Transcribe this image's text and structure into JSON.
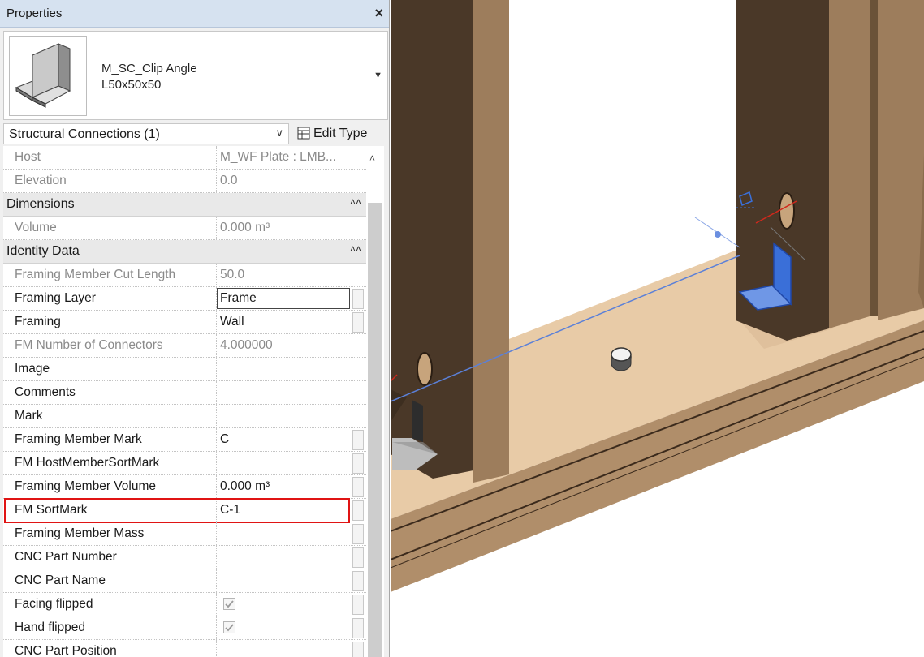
{
  "palette": {
    "title": "Properties",
    "close_glyph": "×",
    "type": {
      "family": "M_SC_Clip Angle",
      "size": "L50x50x50",
      "dropdown_glyph": "▼"
    },
    "filter": {
      "label": "Structural Connections (1)",
      "chevron": "∨"
    },
    "edit_type": {
      "label": "Edit Type",
      "icon": "edit-type-icon"
    },
    "scroll_up_glyph": "˄",
    "collapse_glyph": "˄˄",
    "rows": [
      {
        "kind": "row",
        "label": "Host",
        "value": "M_WF Plate : LMB...",
        "readonly": true,
        "button": false
      },
      {
        "kind": "row",
        "label": "Elevation",
        "value": "0.0",
        "readonly": true,
        "button": false
      },
      {
        "kind": "group",
        "label": "Dimensions"
      },
      {
        "kind": "row",
        "label": "Volume",
        "value": "0.000 m³",
        "readonly": true,
        "button": false
      },
      {
        "kind": "group",
        "label": "Identity Data"
      },
      {
        "kind": "row",
        "label": "Framing Member Cut Length",
        "value": "50.0",
        "readonly": true,
        "button": false
      },
      {
        "kind": "row",
        "label": "Framing Layer",
        "value": "Frame",
        "readonly": false,
        "button": true,
        "editing": true
      },
      {
        "kind": "row",
        "label": "Framing",
        "value": "Wall",
        "readonly": false,
        "button": true
      },
      {
        "kind": "row",
        "label": "FM Number of Connectors",
        "value": "4.000000",
        "readonly": true,
        "button": false
      },
      {
        "kind": "row",
        "label": "Image",
        "value": "",
        "readonly": false,
        "button": false
      },
      {
        "kind": "row",
        "label": "Comments",
        "value": "",
        "readonly": false,
        "button": false
      },
      {
        "kind": "row",
        "label": "Mark",
        "value": "",
        "readonly": false,
        "button": false
      },
      {
        "kind": "row",
        "label": "Framing Member Mark",
        "value": "C",
        "readonly": false,
        "button": true
      },
      {
        "kind": "row",
        "label": "FM HostMemberSortMark",
        "value": "",
        "readonly": false,
        "button": true
      },
      {
        "kind": "row",
        "label": "Framing Member Volume",
        "value": "0.000 m³",
        "readonly": false,
        "button": true
      },
      {
        "kind": "row",
        "label": "FM SortMark",
        "value": "C-1",
        "readonly": false,
        "button": true,
        "highlighted": true
      },
      {
        "kind": "row",
        "label": "Framing Member Mass",
        "value": "",
        "readonly": false,
        "button": true
      },
      {
        "kind": "row",
        "label": "CNC Part Number",
        "value": "",
        "readonly": false,
        "button": true
      },
      {
        "kind": "row",
        "label": "CNC Part Name",
        "value": "",
        "readonly": false,
        "button": true
      },
      {
        "kind": "row",
        "label": "Facing flipped",
        "value": "",
        "readonly": false,
        "button": true,
        "checkbox": true,
        "checked": true
      },
      {
        "kind": "row",
        "label": "Hand flipped",
        "value": "",
        "readonly": false,
        "button": true,
        "checkbox": true,
        "checked": true
      },
      {
        "kind": "row",
        "label": "CNC Part Position",
        "value": "",
        "readonly": false,
        "button": true
      }
    ]
  },
  "viewport": {
    "colors": {
      "stud_front": "#9a7b5b",
      "stud_side": "#4b3a2c",
      "plate_top": "#e4c8a4",
      "plate_front": "#a5835f",
      "selection": "#3a6fd8"
    }
  }
}
